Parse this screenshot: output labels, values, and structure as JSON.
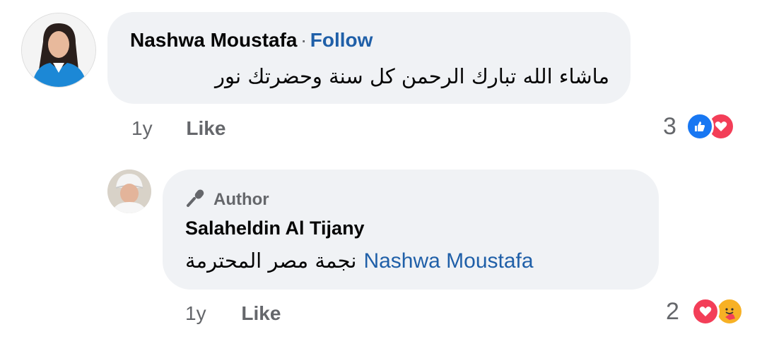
{
  "comments": [
    {
      "author": "Nashwa Moustafa",
      "separator": "·",
      "follow_label": "Follow",
      "text": "ماشاء الله تبارك الرحمن كل سنة وحضرتك نور",
      "age": "1y",
      "like_label": "Like",
      "reaction_count": "3",
      "reactions": [
        "like-reaction-icon",
        "love-reaction-icon"
      ]
    }
  ],
  "reply": {
    "badge": "Author",
    "author": "Salaheldin Al Tijany",
    "mention": "Nashwa Moustafa",
    "text": "نجمة مصر المحترمة",
    "age": "1y",
    "like_label": "Like",
    "reaction_count": "2",
    "reactions": [
      "love-reaction-icon",
      "care-reaction-icon"
    ]
  },
  "colors": {
    "bubble": "#f0f2f5",
    "link": "#1f5fa8",
    "meta": "#65676b",
    "like_blue": "#1877f2",
    "love_red": "#f33e58",
    "care_yellow": "#f7b125"
  }
}
